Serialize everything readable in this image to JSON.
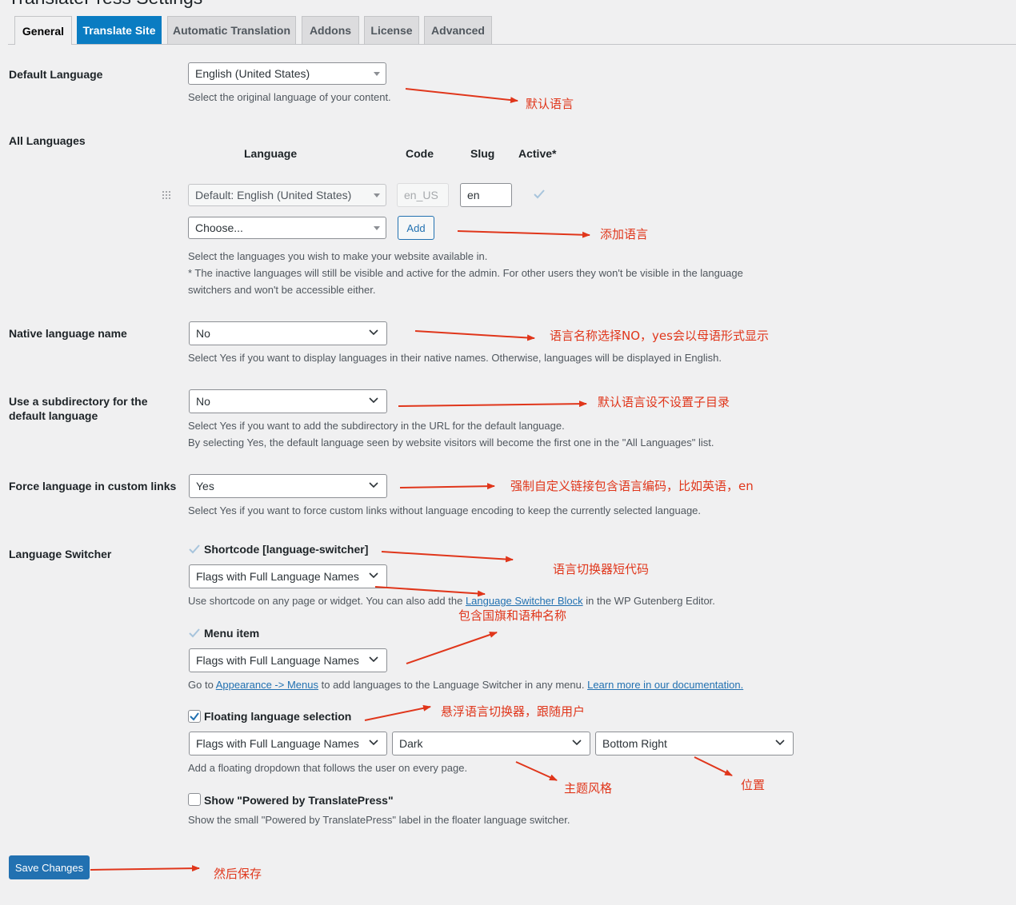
{
  "page_title": "TranslatePress Settings",
  "tabs": [
    {
      "label": "General"
    },
    {
      "label": "Translate Site"
    },
    {
      "label": "Automatic Translation"
    },
    {
      "label": "Addons"
    },
    {
      "label": "License"
    },
    {
      "label": "Advanced"
    }
  ],
  "default_language": {
    "label": "Default Language",
    "value": "English (United States)",
    "description": "Select the original language of your content."
  },
  "all_languages": {
    "label": "All Languages",
    "headers": {
      "language": "Language",
      "code": "Code",
      "slug": "Slug",
      "active": "Active*"
    },
    "row": {
      "language": "Default: English (United States)",
      "code": "en_US",
      "slug": "en",
      "active": true
    },
    "choose_placeholder": "Choose...",
    "add_label": "Add",
    "description_line1": "Select the languages you wish to make your website available in.",
    "description_line2": "* The inactive languages will still be visible and active for the admin. For other users they won't be visible in the language",
    "description_line3": "switchers and won't be accessible either."
  },
  "native_name": {
    "label": "Native language name",
    "value": "No",
    "description": "Select Yes if you want to display languages in their native names. Otherwise, languages will be displayed in English."
  },
  "subdirectory": {
    "label_line1": "Use a subdirectory for the",
    "label_line2": "default language",
    "value": "No",
    "description_line1": "Select Yes if you want to add the subdirectory in the URL for the default language.",
    "description_line2": "By selecting Yes, the default language seen by website visitors will become the first one in the \"All Languages\" list."
  },
  "force_language": {
    "label": "Force language in custom links",
    "value": "Yes",
    "description": "Select Yes if you want to force custom links without language encoding to keep the currently selected language."
  },
  "language_switcher": {
    "label": "Language Switcher",
    "shortcode": {
      "label": "Shortcode [language-switcher]",
      "checked": true,
      "value": "Flags with Full Language Names",
      "desc_before": "Use shortcode on any page or widget. You can also add the",
      "desc_link": "Language Switcher Block",
      "desc_after": "in the WP Gutenberg Editor."
    },
    "menu_item": {
      "label": "Menu item",
      "checked": true,
      "value": "Flags with Full Language Names",
      "desc_before": "Go to",
      "desc_link1": "Appearance -> Menus",
      "desc_middle": "to add languages to the Language Switcher in any menu.",
      "desc_link2": "Learn more in our documentation."
    },
    "floating": {
      "label": "Floating language selection",
      "checked": true,
      "value": "Flags with Full Language Names",
      "theme": "Dark",
      "position": "Bottom Right",
      "description": "Add a floating dropdown that follows the user on every page."
    },
    "powered_by": {
      "label": "Show \"Powered by TranslatePress\"",
      "checked": false,
      "description": "Show the small \"Powered by TranslatePress\" label in the floater language switcher."
    }
  },
  "save_label": "Save Changes",
  "annotations": {
    "default_language": "默认语言",
    "add_language": "添加语言",
    "native_name": "语言名称选择NO，yes会以母语形式显示",
    "subdirectory": "默认语言设不设置子目录",
    "force_language": "强制自定义链接包含语言编码，比如英语，en",
    "shortcode": "语言切换器短代码",
    "flags_names": "包含国旗和语种名称",
    "floating": "悬浮语言切换器，跟随用户",
    "theme": "主题风格",
    "position": "位置",
    "save": "然后保存"
  },
  "colors": {
    "accent": "#2271b1",
    "tab_active_blue": "#0a7cc2",
    "annotation": "#e0361b",
    "background": "#f0f0f1"
  }
}
